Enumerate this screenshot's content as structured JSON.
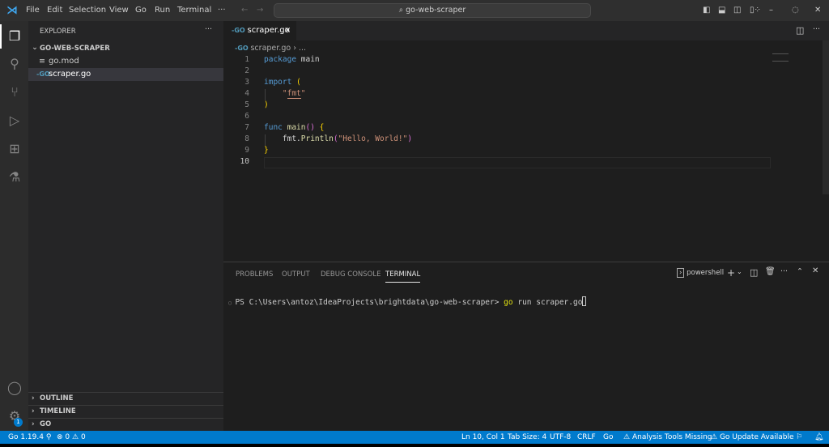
{
  "titlebar": {
    "menu": [
      "File",
      "Edit",
      "Selection",
      "View",
      "Go",
      "Run",
      "Terminal",
      "···"
    ],
    "search": "go-web-scraper",
    "search_icon": "search-icon"
  },
  "explorer": {
    "title": "EXPLORER",
    "more": "···",
    "folder": "GO-WEB-SCRAPER",
    "files": [
      {
        "name": "go.mod",
        "icon": "lines-icon"
      },
      {
        "name": "scraper.go",
        "icon": "go-icon",
        "selected": true
      }
    ],
    "sections": [
      "OUTLINE",
      "TIMELINE",
      "GO"
    ]
  },
  "editor": {
    "tab": "scraper.go",
    "close": "×",
    "breadcrumb": "scraper.go",
    "breadcrumb_more": "›  ...",
    "lines": [
      "1",
      "2",
      "3",
      "4",
      "5",
      "6",
      "7",
      "8",
      "9",
      "10"
    ],
    "code": {
      "l1a": "package",
      "l1b": " main",
      "l3a": "import",
      "l3b": " (",
      "l4a": "    \"",
      "l4b": "fmt",
      "l4c": "\"",
      "l5": ")",
      "l7a": "func",
      "l7b": " main",
      "l7c": "()",
      "l7d": " {",
      "l8a": "    fmt.",
      "l8b": "Println",
      "l8c": "(",
      "l8d": "\"Hello, World!\"",
      "l8e": ")",
      "l9": "}"
    }
  },
  "panel": {
    "tabs": [
      "PROBLEMS",
      "OUTPUT",
      "DEBUG CONSOLE",
      "TERMINAL"
    ],
    "active": "TERMINAL",
    "shell": "powershell",
    "prompt": "PS C:\\Users\\antoz\\IdeaProjects\\brightdata\\go-web-scraper> ",
    "cmd_go": "go",
    "cmd_rest": " run scraper.go"
  },
  "status": {
    "go_version": "Go 1.19.4",
    "errors": "0",
    "warnings": "0",
    "position": "Ln 10, Col 1",
    "tab_size": "Tab Size: 4",
    "encoding": "UTF-8",
    "eol": "CRLF",
    "language": "Go",
    "analysis": "Analysis Tools Missing",
    "update": "Go Update Available",
    "badge": "1"
  },
  "colors": {
    "accent": "#007acc",
    "keyword": "#569cd6",
    "string": "#ce9178",
    "function": "#dcdcaa"
  }
}
